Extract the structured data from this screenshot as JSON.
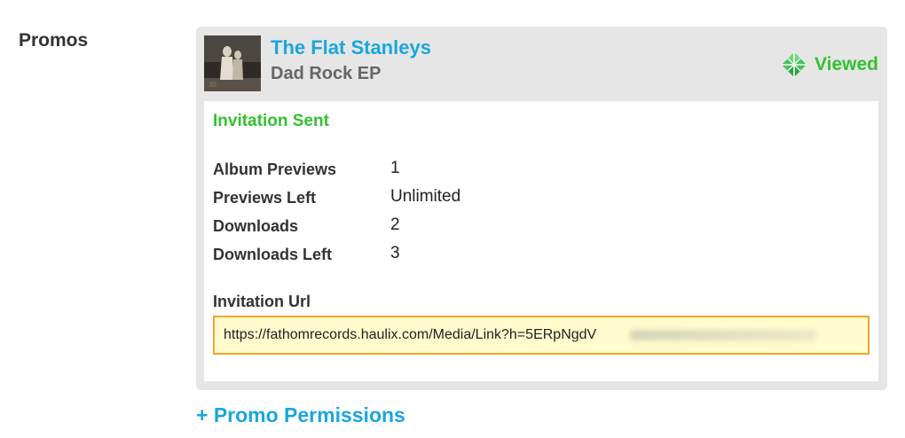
{
  "section": {
    "label": "Promos"
  },
  "promo": {
    "artist": "The Flat Stanleys",
    "album": "Dad Rock EP",
    "status": "Viewed",
    "status_icon": "viewed-diamond-icon",
    "invitation_status": "Invitation Sent",
    "stats": [
      {
        "label": "Album Previews",
        "value": "1"
      },
      {
        "label": "Previews Left",
        "value": "Unlimited"
      },
      {
        "label": "Downloads",
        "value": "2"
      },
      {
        "label": "Downloads Left",
        "value": "3"
      }
    ],
    "invitation_url": {
      "label": "Invitation Url",
      "value": "https://fathomrecords.haulix.com/Media/Link?h=5ERpNgdV"
    }
  },
  "actions": {
    "permissions_label": "+ Promo Permissions"
  },
  "colors": {
    "link": "#1aa6df",
    "status_green": "#33c12f",
    "card_bg": "#e6e6e6",
    "url_highlight": "#fffbcc",
    "url_border": "#f3a32d"
  }
}
